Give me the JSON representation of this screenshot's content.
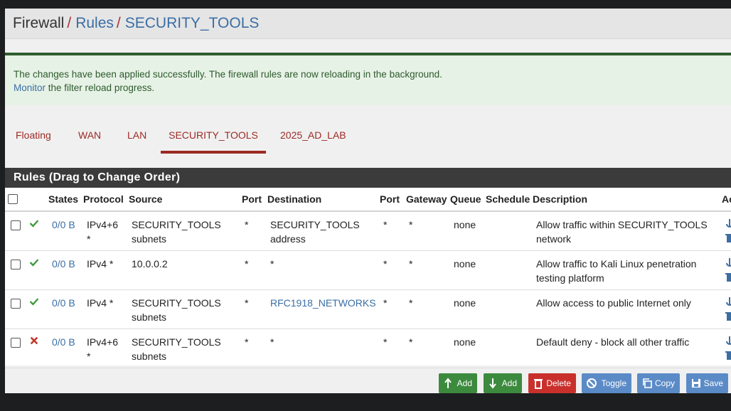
{
  "breadcrumb": {
    "firewall": "Firewall",
    "sep1": "/",
    "rules": "Rules",
    "sep2": "/",
    "current": "SECURITY_TOOLS"
  },
  "alert": {
    "line1": "The changes have been applied successfully. The firewall rules are now reloading in the background.",
    "monitor_link": "Monitor",
    "line2_rest": " the filter reload progress."
  },
  "tabs": [
    {
      "label": "Floating",
      "active": false
    },
    {
      "label": "WAN",
      "active": false
    },
    {
      "label": "LAN",
      "active": false
    },
    {
      "label": "SECURITY_TOOLS",
      "active": true
    },
    {
      "label": "2025_AD_LAB",
      "active": false
    }
  ],
  "panel_title": "Rules (Drag to Change Order)",
  "columns": {
    "states": "States",
    "protocol": "Protocol",
    "source": "Source",
    "port": "Port",
    "destination": "Destination",
    "port2": "Port",
    "gateway": "Gateway",
    "queue": "Queue",
    "schedule": "Schedule",
    "description": "Description",
    "actions": "Actions"
  },
  "rows": [
    {
      "status": "pass",
      "states": "0/0 B",
      "protocol_l1": "IPv4+6",
      "protocol_l2": "*",
      "source_l1": "SECURITY_TOOLS",
      "source_l2": "subnets",
      "port": "*",
      "dest_l1": "SECURITY_TOOLS",
      "dest_l2": "address",
      "dest_is_link": false,
      "dport": "*",
      "gateway": "*",
      "queue": "none",
      "schedule": "",
      "desc_l1": "Allow traffic within SECURITY_TOOLS",
      "desc_l2": "network"
    },
    {
      "status": "pass",
      "states": "0/0 B",
      "protocol_l1": "IPv4 *",
      "protocol_l2": "",
      "source_l1": "10.0.0.2",
      "source_l2": "",
      "port": "*",
      "dest_l1": "*",
      "dest_l2": "",
      "dest_is_link": false,
      "dport": "*",
      "gateway": "*",
      "queue": "none",
      "schedule": "",
      "desc_l1": "Allow traffic to Kali Linux penetration",
      "desc_l2": "testing platform"
    },
    {
      "status": "pass",
      "states": "0/0 B",
      "protocol_l1": "IPv4 *",
      "protocol_l2": "",
      "source_l1": "SECURITY_TOOLS",
      "source_l2": "subnets",
      "port": "*",
      "dest_l1": "RFC1918_NETWORKS",
      "dest_l2": "",
      "dest_is_link": true,
      "dport": "*",
      "gateway": "*",
      "queue": "none",
      "schedule": "",
      "desc_l1": "Allow access to public Internet only",
      "desc_l2": ""
    },
    {
      "status": "block",
      "states": "0/0 B",
      "protocol_l1": "IPv4+6",
      "protocol_l2": "*",
      "source_l1": "SECURITY_TOOLS",
      "source_l2": "subnets",
      "port": "*",
      "dest_l1": "*",
      "dest_l2": "",
      "dest_is_link": false,
      "dport": "*",
      "gateway": "*",
      "queue": "none",
      "schedule": "",
      "desc_l1": "Default deny - block all other traffic",
      "desc_l2": ""
    }
  ],
  "buttons": {
    "add_top": "Add",
    "add_bottom": "Add",
    "delete": "Delete",
    "toggle": "Toggle",
    "copy": "Copy",
    "save": "Save"
  },
  "colors": {
    "pass": "#3c9a3c",
    "block": "#c0392b",
    "accent": "#9c2a25",
    "link": "#3a6ea5"
  }
}
